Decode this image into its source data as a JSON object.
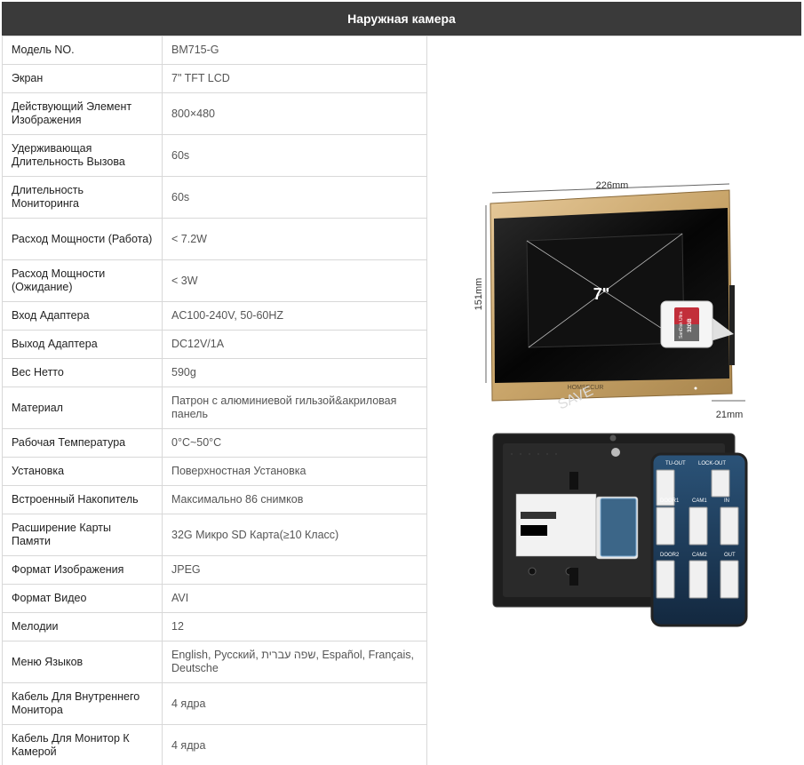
{
  "header": {
    "title": "Наружная камера"
  },
  "specs": [
    {
      "key": "Модель NO.",
      "value": "BM715-G"
    },
    {
      "key": "Экран",
      "value": "7\" TFT LCD"
    },
    {
      "key": "Действующий Элемент Изображения",
      "value": "800×480"
    },
    {
      "key": "Удерживающая Длительность Вызова",
      "value": "60s"
    },
    {
      "key": "Длительность Мониторинга",
      "value": "60s"
    },
    {
      "key": "Расход Мощности (Работа)",
      "value": "< 7.2W"
    },
    {
      "key": "Расход Мощности (Ожидание)",
      "value": "< 3W"
    },
    {
      "key": "Вход Адаптера",
      "value": "AC100-240V, 50-60HZ"
    },
    {
      "key": "Выход Адаптера",
      "value": "DC12V/1A"
    },
    {
      "key": "Вес Нетто",
      "value": "590g"
    },
    {
      "key": "Материал",
      "value": "Патрон с алюминиевой гильзой&акриловая панель"
    },
    {
      "key": "Рабочая Температура",
      "value": "0°C~50°C"
    },
    {
      "key": "Установка",
      "value": "Поверхностная Установка"
    },
    {
      "key": "Встроенный Накопитель",
      "value": "Максимально 86 снимков"
    },
    {
      "key": "Расширение Карты Памяти",
      "value": "32G Микро SD Карта(≥10 Класс)"
    },
    {
      "key": "Формат Изображения",
      "value": "JPEG"
    },
    {
      "key": "Формат Видео",
      "value": "AVI"
    },
    {
      "key": "Мелодии",
      "value": "12"
    },
    {
      "key": "Меню Языков",
      "value": "English, Русский, שפה עברית, Español, Français, Deutsche"
    },
    {
      "key": "Кабель Для Внутреннего Монитора",
      "value": "4 ядра"
    },
    {
      "key": "Кабель Для Монитор К Камерой",
      "value": "4 ядра"
    }
  ],
  "figure": {
    "dim_width": "226mm",
    "dim_height": "151mm",
    "dim_depth": "21mm",
    "screen_size": "7\"",
    "brand": "HOMSECUR",
    "watermark": "SAVE",
    "sd_card": "SanDisk Ultra",
    "sd_capacity": "32GB",
    "connector_labels": [
      "TU-OUT",
      "LOCK-OUT",
      "DOOR1",
      "CAM1",
      "IN",
      "DOOR2",
      "CAM2",
      "OUT"
    ],
    "colors": {
      "frame_gold": "#c9a56a",
      "screen_black": "#0a0a0a",
      "board_blue": "#1c3a5c"
    }
  }
}
